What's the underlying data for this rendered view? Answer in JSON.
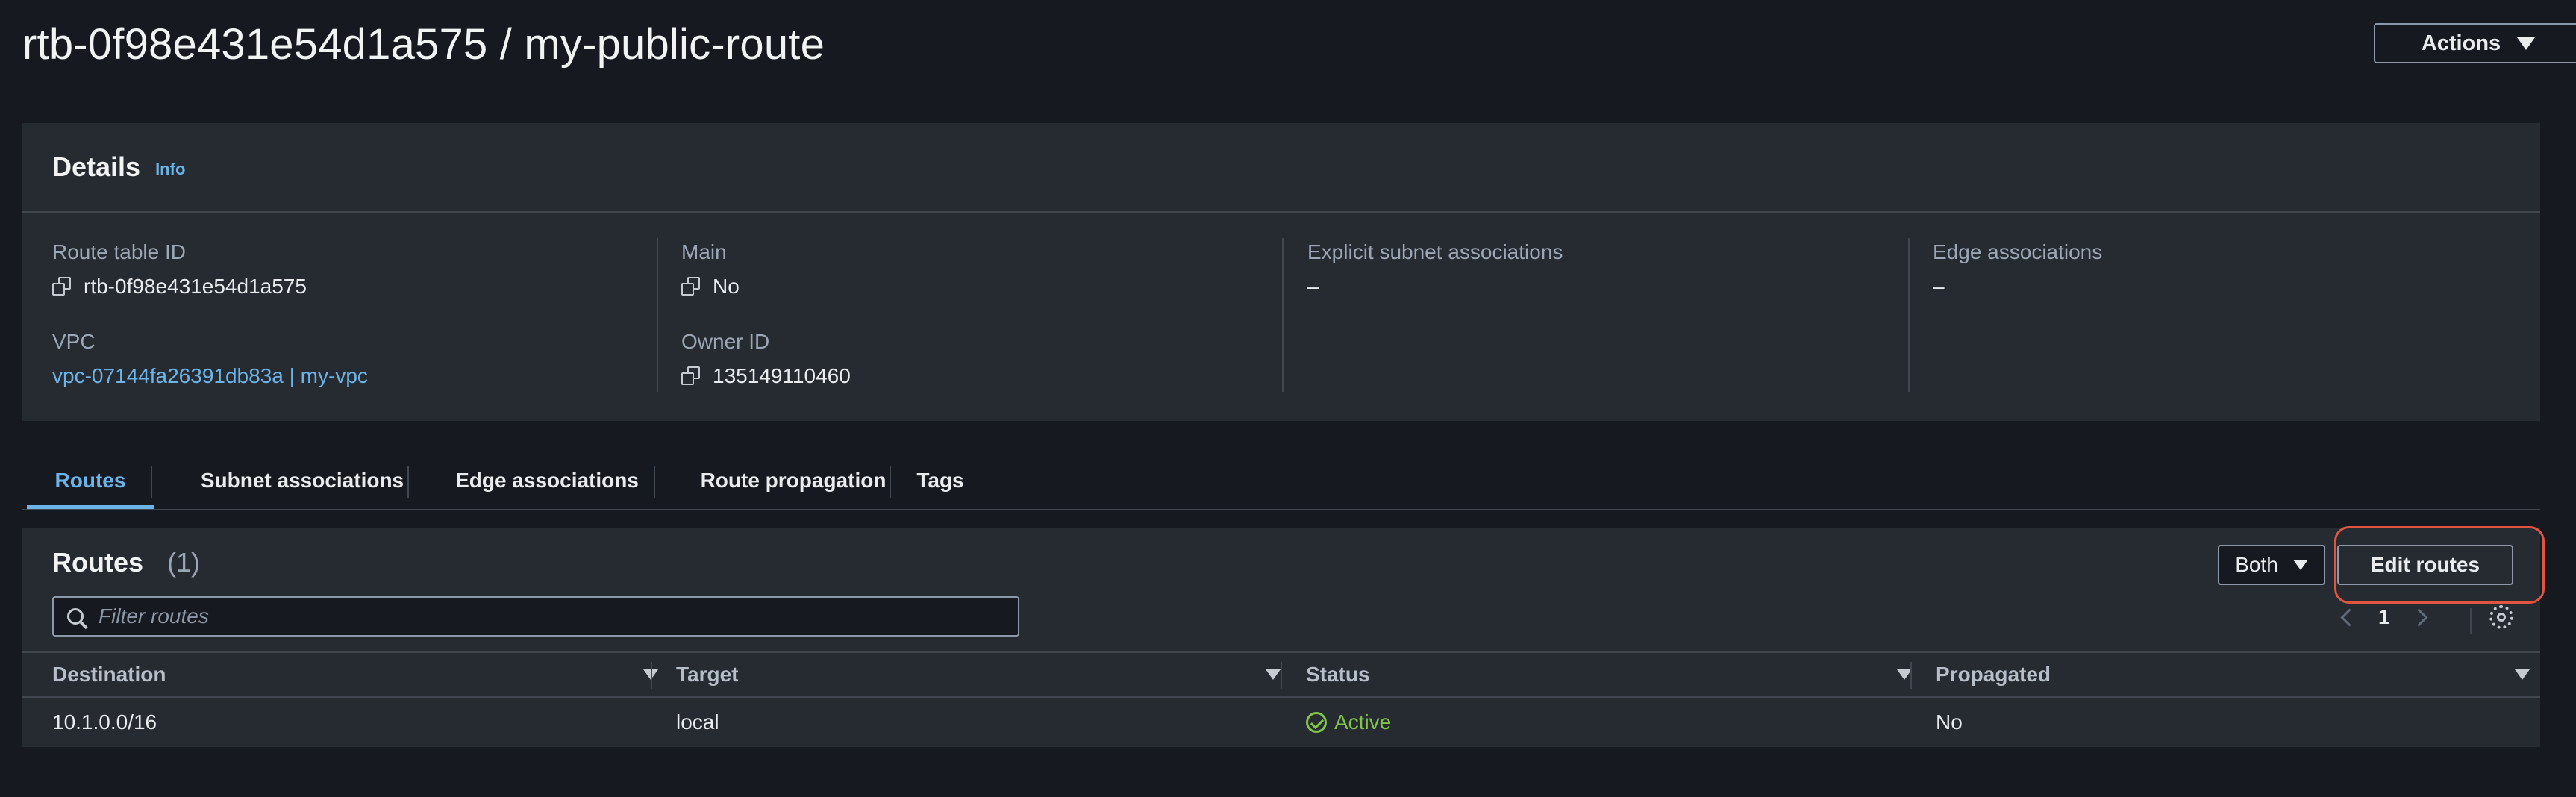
{
  "page": {
    "title": "rtb-0f98e431e54d1a575 / my-public-route",
    "actions_label": "Actions"
  },
  "details": {
    "title": "Details",
    "info_label": "Info",
    "route_table_id_label": "Route table ID",
    "route_table_id_value": "rtb-0f98e431e54d1a575",
    "vpc_label": "VPC",
    "vpc_value": "vpc-07144fa26391db83a | my-vpc",
    "main_label": "Main",
    "main_value": "No",
    "owner_id_label": "Owner ID",
    "owner_id_value": "135149110460",
    "explicit_subnet_label": "Explicit subnet associations",
    "explicit_subnet_value": "–",
    "edge_assoc_label": "Edge associations",
    "edge_assoc_value": "–"
  },
  "tabs": [
    {
      "label": "Routes",
      "active": true
    },
    {
      "label": "Subnet associations"
    },
    {
      "label": "Edge associations"
    },
    {
      "label": "Route propagation"
    },
    {
      "label": "Tags"
    }
  ],
  "routes": {
    "title": "Routes",
    "count": "(1)",
    "filter_placeholder": "Filter routes",
    "select_value": "Both",
    "edit_label": "Edit routes",
    "page_number": "1",
    "columns": [
      "Destination",
      "Target",
      "Status",
      "Propagated"
    ],
    "rows": [
      {
        "destination": "10.1.0.0/16",
        "target": "local",
        "status": "Active",
        "propagated": "No"
      }
    ]
  },
  "colors": {
    "background": "#16191f",
    "panel": "#262a31",
    "link": "#6cb4e8",
    "status_active": "#82c34a",
    "highlight": "#e0553f"
  },
  "icons": [
    "copy-icon",
    "search-icon",
    "chevron-left-icon",
    "chevron-right-icon",
    "gear-icon",
    "check-circle-icon",
    "caret-down-icon"
  ]
}
